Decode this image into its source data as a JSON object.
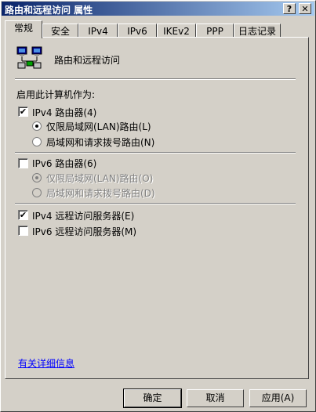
{
  "window": {
    "title": "路由和远程访问 属性",
    "help_glyph": "?",
    "close_glyph": "✕"
  },
  "tabs": [
    {
      "label": "常规"
    },
    {
      "label": "安全"
    },
    {
      "label": "IPv4"
    },
    {
      "label": "IPv6"
    },
    {
      "label": "IKEv2"
    },
    {
      "label": "PPP"
    },
    {
      "label": "日志记录"
    }
  ],
  "general": {
    "service_name": "路由和远程访问",
    "enable_heading": "启用此计算机作为:",
    "ipv4_router": {
      "label": "IPv4 路由器(4)",
      "checked": true,
      "lan_only": "仅限局域网(LAN)路由(L)",
      "lan_dial": "局域网和请求拨号路由(N)"
    },
    "ipv6_router": {
      "label": "IPv6 路由器(6)",
      "checked": false,
      "lan_only": "仅限局域网(LAN)路由(O)",
      "lan_dial": "局域网和请求拨号路由(D)"
    },
    "ipv4_ras": {
      "label": "IPv4 远程访问服务器(E)",
      "checked": true
    },
    "ipv6_ras": {
      "label": "IPv6 远程访问服务器(M)",
      "checked": false
    },
    "more_info": "有关详细信息",
    "check_glyph": "✔"
  },
  "buttons": {
    "ok": "确定",
    "cancel": "取消",
    "apply": "应用(A)"
  },
  "icons": {
    "service": "network-computers-icon"
  }
}
